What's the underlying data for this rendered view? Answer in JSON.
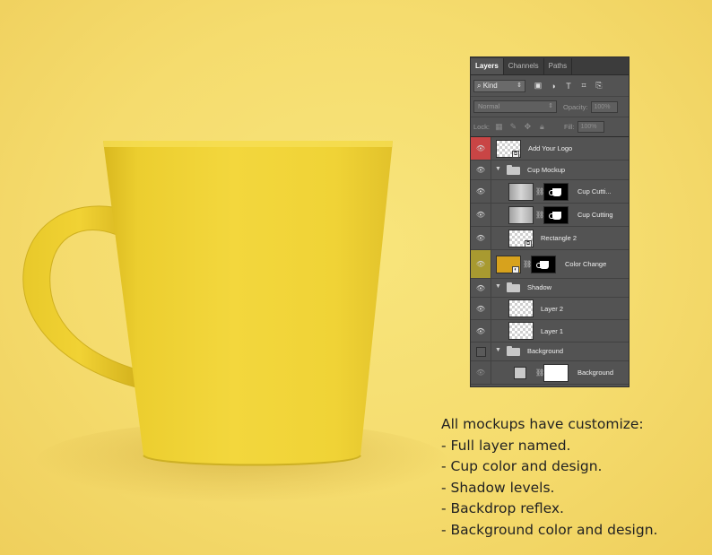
{
  "panel": {
    "tabs": [
      "Layers",
      "Channels",
      "Paths"
    ],
    "filter_kind": "Kind",
    "blend_mode": "Normal",
    "opacity_label": "Opacity:",
    "opacity_value": "100%",
    "lock_label": "Lock:",
    "fill_label": "Fill:",
    "fill_value": "100%",
    "layers": [
      {
        "name": "Add Your Logo",
        "type": "smart-object",
        "highlight": "red"
      },
      {
        "name": "Cup Mockup",
        "type": "group"
      },
      {
        "name": "Cup Cutti...",
        "type": "masked"
      },
      {
        "name": "Cup Cutting",
        "type": "masked"
      },
      {
        "name": "Rectangle 2",
        "type": "smart-object"
      },
      {
        "name": "Color Change",
        "type": "fill-masked",
        "highlight": "gold"
      },
      {
        "name": "Shadow",
        "type": "group"
      },
      {
        "name": "Layer 2",
        "type": "pixel"
      },
      {
        "name": "Layer 1",
        "type": "pixel"
      },
      {
        "name": "Background",
        "type": "group",
        "hidden": true
      },
      {
        "name": "Background",
        "type": "fill-masked"
      }
    ]
  },
  "features": {
    "heading": "All mockups have customize:",
    "items": [
      "- Full layer named.",
      "- Cup color and design.",
      "- Shadow levels.",
      "- Backdrop reflex.",
      "- Background color and design."
    ]
  },
  "colors": {
    "background": "#f5dc6e",
    "mug": "#f0d33a",
    "panel": "#535353",
    "highlight_red": "#c94545",
    "highlight_gold": "#a89a30"
  }
}
